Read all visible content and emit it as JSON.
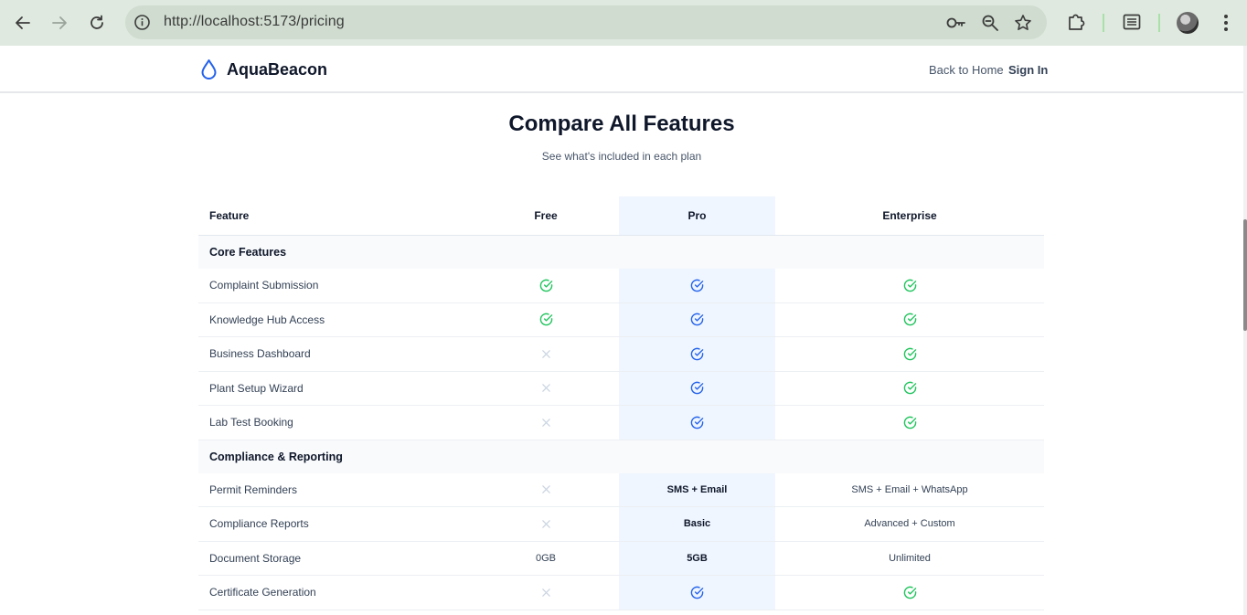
{
  "browser": {
    "url": "http://localhost:5173/pricing",
    "icons": [
      "back-arrow-icon",
      "forward-arrow-icon",
      "reload-icon",
      "site-info-icon",
      "password-key-icon",
      "zoom-icon",
      "bookmark-star-icon",
      "extensions-puzzle-icon",
      "reading-list-icon",
      "profile-avatar",
      "menu-kebab-icon"
    ]
  },
  "header": {
    "brand": "AquaBeacon",
    "logo_icon": "water-drop-icon",
    "back_home": "Back to Home",
    "sign_in": "Sign In"
  },
  "section": {
    "title": "Compare All Features",
    "subtitle": "See what's included in each plan"
  },
  "table": {
    "columns": [
      "Feature",
      "Free",
      "Pro",
      "Enterprise"
    ],
    "groups": [
      {
        "name": "Core Features",
        "rows": [
          {
            "feature": "Complaint Submission",
            "free": "check",
            "pro": "check",
            "enterprise": "check"
          },
          {
            "feature": "Knowledge Hub Access",
            "free": "check",
            "pro": "check",
            "enterprise": "check"
          },
          {
            "feature": "Business Dashboard",
            "free": "cross",
            "pro": "check",
            "enterprise": "check"
          },
          {
            "feature": "Plant Setup Wizard",
            "free": "cross",
            "pro": "check",
            "enterprise": "check"
          },
          {
            "feature": "Lab Test Booking",
            "free": "cross",
            "pro": "check",
            "enterprise": "check"
          }
        ]
      },
      {
        "name": "Compliance & Reporting",
        "rows": [
          {
            "feature": "Permit Reminders",
            "free": "cross",
            "pro": "SMS + Email",
            "enterprise": "SMS + Email + WhatsApp"
          },
          {
            "feature": "Compliance Reports",
            "free": "cross",
            "pro": "Basic",
            "enterprise": "Advanced + Custom"
          },
          {
            "feature": "Document Storage",
            "free": "0GB",
            "pro": "5GB",
            "enterprise": "Unlimited"
          },
          {
            "feature": "Certificate Generation",
            "free": "cross",
            "pro": "check",
            "enterprise": "check"
          }
        ]
      }
    ]
  },
  "colors": {
    "check_green": "#22c55e",
    "check_blue": "#2563eb",
    "cross_gray": "#cbd5e1",
    "pro_column_bg": "#eff6ff",
    "brand_blue": "#2563eb"
  }
}
